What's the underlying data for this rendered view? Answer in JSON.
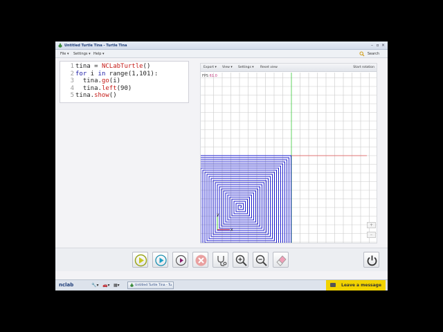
{
  "window": {
    "title": "Untitled Turtle Tina - Turtle Tina",
    "controls": [
      "–",
      "▫",
      "×"
    ]
  },
  "menubar": {
    "items": [
      "File ▾",
      "Settings ▾",
      "Help ▾"
    ],
    "search_label": "Search"
  },
  "editor": {
    "line_numbers": [
      "1",
      "2",
      "3",
      "4",
      "5"
    ],
    "lines": [
      [
        {
          "t": "tina = ",
          "c": ""
        },
        {
          "t": "NCLabTurtle",
          "c": "fn"
        },
        {
          "t": "()",
          "c": ""
        }
      ],
      [
        {
          "t": "for",
          "c": "kw"
        },
        {
          "t": " i ",
          "c": ""
        },
        {
          "t": "in",
          "c": "kw"
        },
        {
          "t": " range(1,101):",
          "c": ""
        }
      ],
      [
        {
          "t": "  tina.",
          "c": ""
        },
        {
          "t": "go",
          "c": "fn"
        },
        {
          "t": "(i)",
          "c": ""
        }
      ],
      [
        {
          "t": "  tina.",
          "c": ""
        },
        {
          "t": "left",
          "c": "fn"
        },
        {
          "t": "(90)",
          "c": ""
        }
      ],
      [
        {
          "t": "tina.",
          "c": ""
        },
        {
          "t": "show",
          "c": "fn"
        },
        {
          "t": "()",
          "c": ""
        }
      ]
    ]
  },
  "graphics": {
    "toolbar": [
      "Export ▾",
      "View ▾",
      "Settings ▾",
      "Reset view"
    ],
    "start_rotation": "Start rotation",
    "fps_label": "FPS",
    "fps_value": "61.0",
    "axis_x": "x",
    "axis_y": "y",
    "zoom_in": "+",
    "zoom_out": "–",
    "colors": {
      "spiral": "#1a1acc",
      "axis_red": "#e05050",
      "axis_green": "#40d040",
      "grid": "#c9c9c9"
    }
  },
  "toolbar": {
    "buttons": [
      "play-icon",
      "play-step-icon",
      "play-small-icon",
      "stop-icon",
      "stethoscope-icon",
      "zoom-in-icon",
      "zoom-out-icon",
      "eraser-icon",
      "power-icon"
    ]
  },
  "taskbar": {
    "logo": "nclab",
    "task_label": "Untitled Turtle Tina - Tu",
    "leave_message": "Leave a message"
  }
}
